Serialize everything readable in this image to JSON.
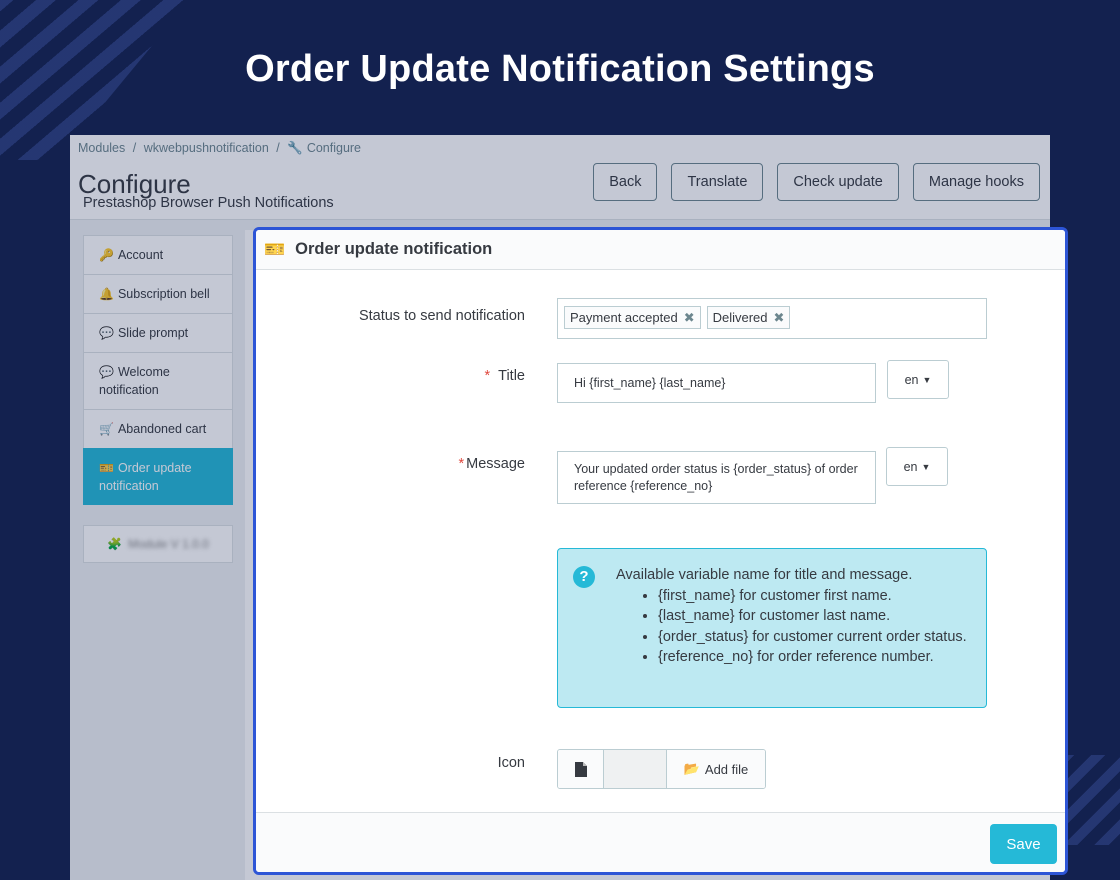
{
  "hero": {
    "title": "Order Update Notification Settings"
  },
  "admin": {
    "breadcrumb": [
      "Modules",
      "/",
      "wkwebpushnotification",
      "/",
      "Configure"
    ],
    "page_title": "Configure",
    "page_subtitle": "Prestashop Browser Push Notifications",
    "toolbar": {
      "back": "Back",
      "translate": "Translate",
      "check_update": "Check update",
      "manage_hooks": "Manage hooks"
    },
    "nav": [
      {
        "label": "Account",
        "icon": "key-icon"
      },
      {
        "label": "Subscription bell",
        "icon": "bell-icon"
      },
      {
        "label": "Slide prompt",
        "icon": "comments-icon"
      },
      {
        "label": "Welcome notification",
        "icon": "comments-icon"
      },
      {
        "label": "Abandoned cart",
        "icon": "cart-icon"
      },
      {
        "label": "Order update notification",
        "icon": "ticket-icon",
        "active": true
      }
    ],
    "version_label": "Module V 1.0.0"
  },
  "card": {
    "title": "Order update notification",
    "status_label": "Status to send notification",
    "status_tags": [
      "Payment accepted",
      "Delivered"
    ],
    "title_label": "Title",
    "title_value": "Hi {first_name} {last_name}",
    "title_lang": "en",
    "message_label": "Message",
    "message_value": "Your updated order status is {order_status} of order reference {reference_no}",
    "message_lang": "en",
    "help_intro": "Available variable name for title and message.",
    "help_items": [
      "{first_name} for customer first name.",
      "{last_name} for customer last name.",
      "{order_status} for customer current order status.",
      "{reference_no} for order reference number."
    ],
    "icon_label": "Icon",
    "add_file": "Add file",
    "save": "Save"
  },
  "colors": {
    "background": "#13214f",
    "accent": "#25b9d7",
    "card_border": "#2d55d6",
    "required": "#e0483e"
  }
}
